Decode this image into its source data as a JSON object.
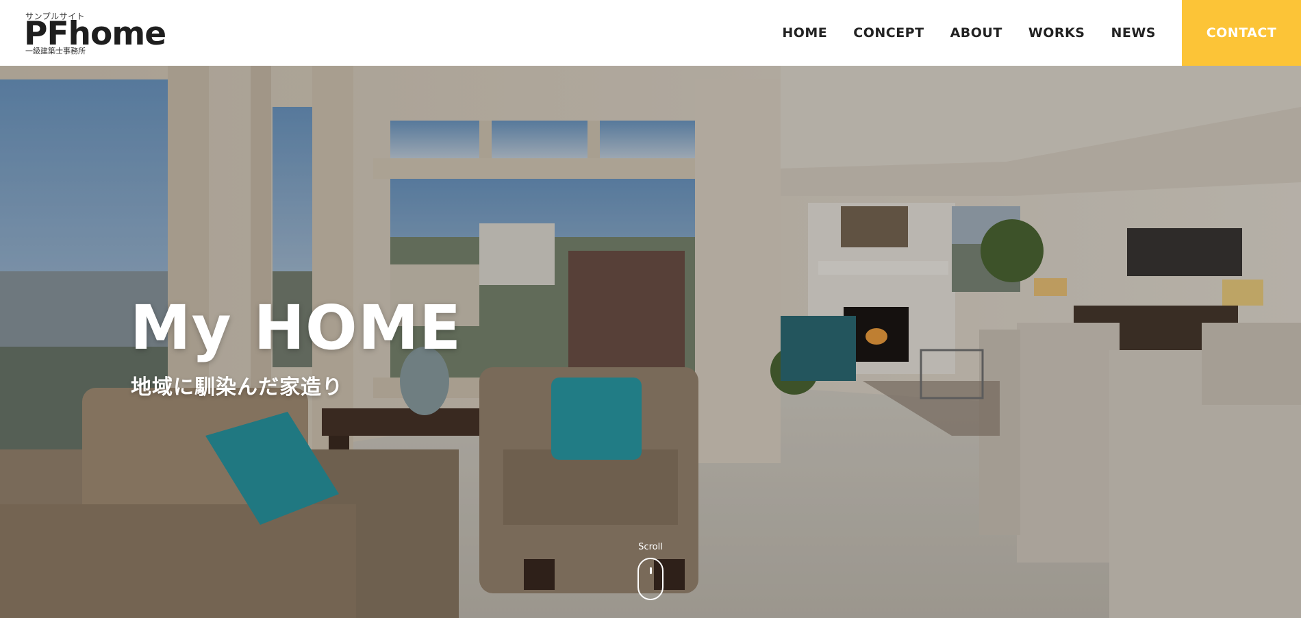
{
  "header": {
    "logo": {
      "sub": "サンプルサイト",
      "main": "PFhome",
      "caption": "一級建築士事務所"
    },
    "nav": [
      {
        "label": "HOME"
      },
      {
        "label": "CONCEPT"
      },
      {
        "label": "ABOUT"
      },
      {
        "label": "WORKS"
      },
      {
        "label": "NEWS"
      }
    ],
    "contact_label": "CONTACT"
  },
  "hero": {
    "title": "My HOME",
    "subtitle": "地域に馴染んだ家造り",
    "scroll_label": "Scroll"
  },
  "colors": {
    "accent": "#fcc437",
    "header_bg": "#ffffff",
    "nav_text": "#222222",
    "hero_text": "#ffffff"
  }
}
